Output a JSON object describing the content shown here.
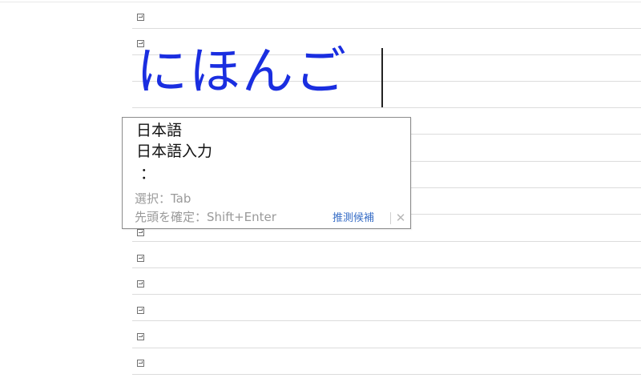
{
  "editor": {
    "composition_text": "にほんご"
  },
  "candidate_window": {
    "candidates": [
      "日本語",
      "日本語入力",
      "："
    ],
    "hints": {
      "select": "選択：Tab",
      "commit_first": "先頭を確定：Shift+Enter"
    },
    "prediction_label": "推測候補",
    "close_icon": "close-icon"
  },
  "colors": {
    "composition_text": "#1a2ee0",
    "prediction_link": "#3a6fc7",
    "hint_text": "#9a9a9a"
  }
}
